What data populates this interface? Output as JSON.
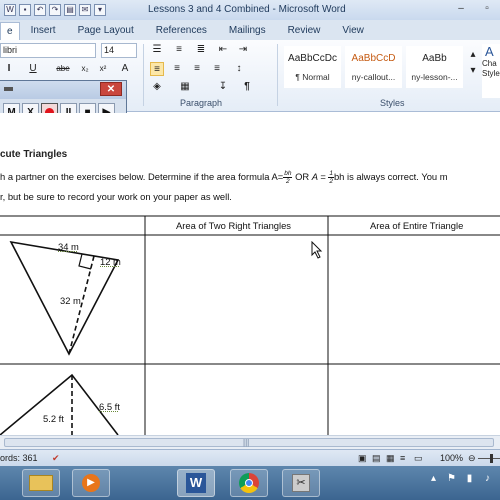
{
  "window": {
    "title": "Lessons 3 and 4 Combined - Microsoft Word"
  },
  "qat_icons": [
    "save-icon",
    "undo-icon",
    "redo-icon"
  ],
  "tabs": [
    {
      "label": "e",
      "active": true
    },
    {
      "label": "Insert"
    },
    {
      "label": "Page Layout"
    },
    {
      "label": "References"
    },
    {
      "label": "Mailings"
    },
    {
      "label": "Review"
    },
    {
      "label": "View"
    }
  ],
  "ribbon": {
    "font_name": "libri",
    "font_size": "14",
    "paragraph_label": "Paragraph",
    "styles_label": "Styles",
    "styles": [
      {
        "preview": "AaBbCcDc",
        "name": "¶ Normal"
      },
      {
        "preview": "AaBbCcD",
        "name": "ny-callout..."
      },
      {
        "preview": "AaBb",
        "name": "ny-lesson-..."
      }
    ],
    "change_styles_label": "Cha\nStyle"
  },
  "recorder": {
    "buttons": [
      "M",
      "X",
      "●",
      "II",
      "■",
      "▶"
    ]
  },
  "document": {
    "heading": "cute Triangles",
    "para_line1_a": "h a partner on the exercises below.  Determine if the area formula A=",
    "para_line1_frac_num": "bh",
    "para_line1_frac_den": "2",
    "para_line1_b": " OR ",
    "para_line1_c": "A = ",
    "para_line1_frac2_num": "1",
    "para_line1_frac2_den": "2",
    "para_line1_d": "bh is always correct.  You m",
    "para_line2": "r, but be sure to record your work on your paper as well.",
    "col_header_1": "Area of Two Right Triangles",
    "col_header_2": "Area of Entire Triangle",
    "triangle1": {
      "top_label": "34 m",
      "right_label": "12 m",
      "height_label": "32 m"
    },
    "triangle2": {
      "left_label": "5.2 ft",
      "right_label": "6.5 ft"
    }
  },
  "statusbar": {
    "words": "ords: 361",
    "zoom": "100%",
    "zoom_level": 1.0
  },
  "taskbar_icons": [
    "explorer-icon",
    "media-player-icon",
    "word-icon",
    "chrome-icon",
    "snipping-icon"
  ],
  "colors": {
    "ribbon_blue": "#1e395b",
    "file_tab": "#2a5699",
    "record_red": "#e0141c",
    "selection_yellow": "#fce7a8"
  }
}
